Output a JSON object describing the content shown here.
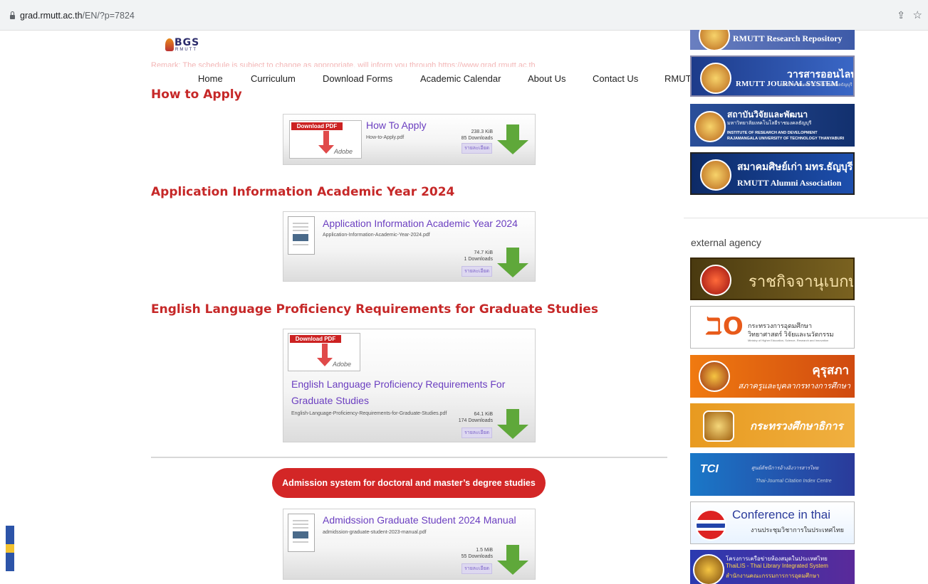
{
  "browser": {
    "url_domain": "grad.rmutt.ac.th",
    "url_path": "/EN/?p=7824"
  },
  "logo": {
    "letters": "BGS",
    "sub": "RMUTT"
  },
  "remark": "Remark: The schedule is subject to change as appropriate, will inform you through https://www.grad.rmutt.ac.th",
  "nav": [
    "Home",
    "Curriculum",
    "Download Forms",
    "Academic Calendar",
    "About Us",
    "Contact Us",
    "RMUTT Department"
  ],
  "sections": [
    {
      "heading": "How to Apply"
    },
    {
      "heading": "Application Information Academic Year 2024"
    },
    {
      "heading": "English Language Proficiency Requirements for Graduate Studies"
    }
  ],
  "downloads": [
    {
      "title": "How To Apply",
      "file": "How-to-Apply.pdf",
      "size": "238.3 KiB",
      "count": "85 Downloads",
      "details": "รายละเอียด",
      "pdf_tag": "Download PDF",
      "pdf_brand": "Adobe"
    },
    {
      "title": "Application Information Academic Year 2024",
      "file": "Application-Information-Academic-Year-2024.pdf",
      "size": "74.7 KiB",
      "count": "1 Downloads",
      "details": "รายละเอียด"
    },
    {
      "title_line1": "English Language Proficiency Requirements For",
      "title_line2": "Graduate Studies",
      "file": "English-Language-Proficiency-Requirements-for-Graduate-Studies.pdf",
      "size": "64.1 KiB",
      "count": "174 Downloads",
      "details": "รายละเอียด",
      "pdf_tag": "Download PDF",
      "pdf_brand": "Adobe"
    },
    {
      "title": "Admidssion Graduate Student 2024 Manual",
      "file": "admidssion-graduate-student-2023-manual.pdf",
      "size": "1.5 MiB",
      "count": "55 Downloads",
      "details": "รายละเอียด"
    }
  ],
  "admission_button": "Admission system for doctoral and master’s degree studies",
  "sidebar": {
    "research_repository": "RMUTT Research Repository",
    "journal": {
      "left": "RMUTT JOURNAL SYSTEM",
      "right": "วารสารออนไลน์",
      "sub": "มหาวิทยาลัยเทคโนโลยีราชมงคลธัญบุรี"
    },
    "ird": {
      "th": "สถาบันวิจัยและพัฒนา",
      "th_sub": "มหาวิทยาลัยเทคโนโลยีราชมงคลธัญบุรี",
      "en1": "INSTITUTE OF RESEARCH AND DEVELOPMENT",
      "en2": "RAJAMANGALA UNIVERSITY OF TECHNOLOGY THANYABURI"
    },
    "alumni": {
      "th": "สมาคมศิษย์เก่า มทร.ธัญบุรี",
      "en": "RMUTT Alumni Association"
    },
    "external_label": "external agency",
    "gazette": "ราชกิจจานุเบกษา",
    "mhesi": {
      "l1": "กระทรวงการอุดมศึกษา",
      "l2": "วิทยาศาสตร์ วิจัยและนวัตกรรม",
      "l3": "Ministry of Higher Education, Science, Research and Innovation"
    },
    "teachers": {
      "l1": "คุรุสภา",
      "l2": "สภาครูและบุคลากรทางการศึกษา"
    },
    "moe": "กระทรวงศึกษาธิการ",
    "tci": {
      "logo": "TCI",
      "l1": "ศูนย์ดัชนีการอ้างอิงวารสารไทย",
      "l2": "Thai-Journal Citation Index Centre"
    },
    "conference": {
      "l1": "Conference in thai",
      "l2": "งานประชุมวิชาการในประเทศไทย"
    },
    "thailis": {
      "l1": "โครงการเครือข่ายห้องสมุดในประเทศไทย",
      "l2": "ThaiLIS - Thai Library Integrated System",
      "l3": "สำนักงานคณะกรรมการการอุดมศึกษา"
    }
  }
}
